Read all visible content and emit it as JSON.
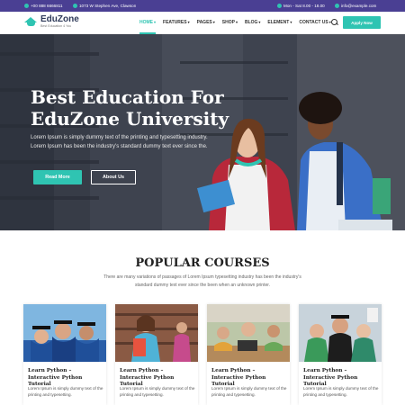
{
  "topbar": {
    "phone": "+00 888 6666811",
    "address": "1073 W Stephen Ave, Clawson",
    "hours": "Mon - Sat 8.00 - 18.00",
    "email": "info@example.com"
  },
  "brand": {
    "name": "EduZone",
    "tagline": "Best Education 4 You"
  },
  "nav": {
    "items": [
      {
        "label": "HOME",
        "active": true
      },
      {
        "label": "FEATURES",
        "active": false
      },
      {
        "label": "PAGES",
        "active": false
      },
      {
        "label": "SHOP",
        "active": false
      },
      {
        "label": "BLOG",
        "active": false
      },
      {
        "label": "ELEMENT",
        "active": false
      },
      {
        "label": "CONTACT US",
        "active": false
      }
    ],
    "apply_label": "Apply Now"
  },
  "hero": {
    "title_line1": "Best Education For",
    "title_line2": "EduZone University",
    "subtitle": "Lorem Ipsum is simply dummy text of the printing and typesetting industry. Lorem Ipsum has been the industry's standard dummy text ever since the.",
    "read_more": "Read More",
    "about_us": "About Us"
  },
  "courses": {
    "heading": "POPULAR COURSES",
    "intro": "There are many variations of passages of Lorem Ipsum typesetting industry has been the industry's standard dummy text ever since the been when an unknown printer.",
    "cards": [
      {
        "title": "Learn Python – Interactive Python Tutorial",
        "text": "Lorem Ipsum is simply dummy text of the printing and typesetting."
      },
      {
        "title": "Learn Python – Interactive Python Tutorial",
        "text": "Lorem Ipsum is simply dummy text of the printing and typesetting."
      },
      {
        "title": "Learn Python – Interactive Python Tutorial",
        "text": "Lorem Ipsum is simply dummy text of the printing and typesetting."
      },
      {
        "title": "Learn Python – Interactive Python Tutorial",
        "text": "Lorem Ipsum is simply dummy text of the printing and typesetting."
      }
    ]
  },
  "colors": {
    "accent": "#2fc4b2",
    "topbar": "#4a3f93"
  }
}
